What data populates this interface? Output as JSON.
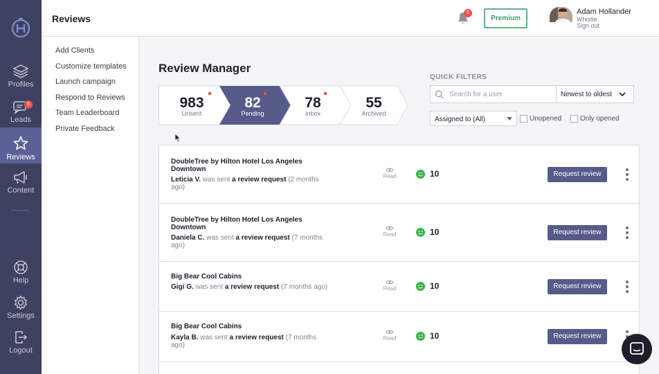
{
  "app": {
    "page_title": "Reviews"
  },
  "rail": {
    "items": [
      {
        "label": "Profiles",
        "icon": "layers-icon"
      },
      {
        "label": "Leads",
        "icon": "chat-icon",
        "badge": "5"
      },
      {
        "label": "Reviews",
        "icon": "star-icon",
        "active": true
      },
      {
        "label": "Content",
        "icon": "megaphone-icon"
      },
      {
        "label": "Help",
        "icon": "lifebuoy-icon"
      },
      {
        "label": "Settings",
        "icon": "gear-icon"
      },
      {
        "label": "Logout",
        "icon": "logout-icon"
      }
    ]
  },
  "header": {
    "notifications_badge": "5",
    "premium_label": "Premium",
    "user": {
      "name": "Adam Hollander",
      "org": "Whistle",
      "signout": "Sign out"
    }
  },
  "submenu": {
    "items": [
      "Add Clients",
      "Customize templates",
      "Launch campaign",
      "Respond to Reviews",
      "Team Leaderboard",
      "Private Feedback"
    ]
  },
  "main": {
    "title": "Review Manager",
    "stats": [
      {
        "count": "983",
        "label": "Unsent",
        "dot": true,
        "active": false
      },
      {
        "count": "82",
        "label": "Pending",
        "dot": true,
        "active": true
      },
      {
        "count": "78",
        "label": "Inbox",
        "dot": true,
        "active": false
      },
      {
        "count": "55",
        "label": "Archived",
        "dot": false,
        "active": false
      }
    ]
  },
  "filters": {
    "title": "QUICK FILTERS",
    "search_placeholder": "Search for a user",
    "sort_value": "Newest to oldest",
    "assigned_value": "Assigned to (All)",
    "unopened_label": "Unopened",
    "only_opened_label": "Only opened"
  },
  "reviews": [
    {
      "business": "DoubleTree by Hilton Hotel Los Angeles Downtown",
      "person": "Leticia V.",
      "sent_text": "was sent",
      "action": "a review request",
      "when": "(2 months ago)",
      "status": "Read",
      "score": "10",
      "button": "Request review"
    },
    {
      "business": "DoubleTree by Hilton Hotel Los Angeles Downtown",
      "person": "Daniela C.",
      "sent_text": "was sent",
      "action": "a review request",
      "when": "(7 months ago)",
      "status": "Read",
      "score": "10",
      "button": "Request review"
    },
    {
      "business": "Big Bear Cool Cabins",
      "person": "Gigi G.",
      "sent_text": "was sent",
      "action": "a review request",
      "when": "(7 months ago)",
      "status": "Read",
      "score": "10",
      "button": "Request review"
    },
    {
      "business": "Big Bear Cool Cabins",
      "person": "Kayla B.",
      "sent_text": "was sent",
      "action": "a review request",
      "when": "(7 months ago)",
      "status": "Read",
      "score": "10",
      "button": "Request review"
    }
  ],
  "colors": {
    "rail_bg": "#3e415f",
    "rail_active": "#5b6196",
    "accent": "#565b8a",
    "badge": "#e8534b",
    "premium_green": "#5bb784",
    "score_green": "#39b54a"
  }
}
